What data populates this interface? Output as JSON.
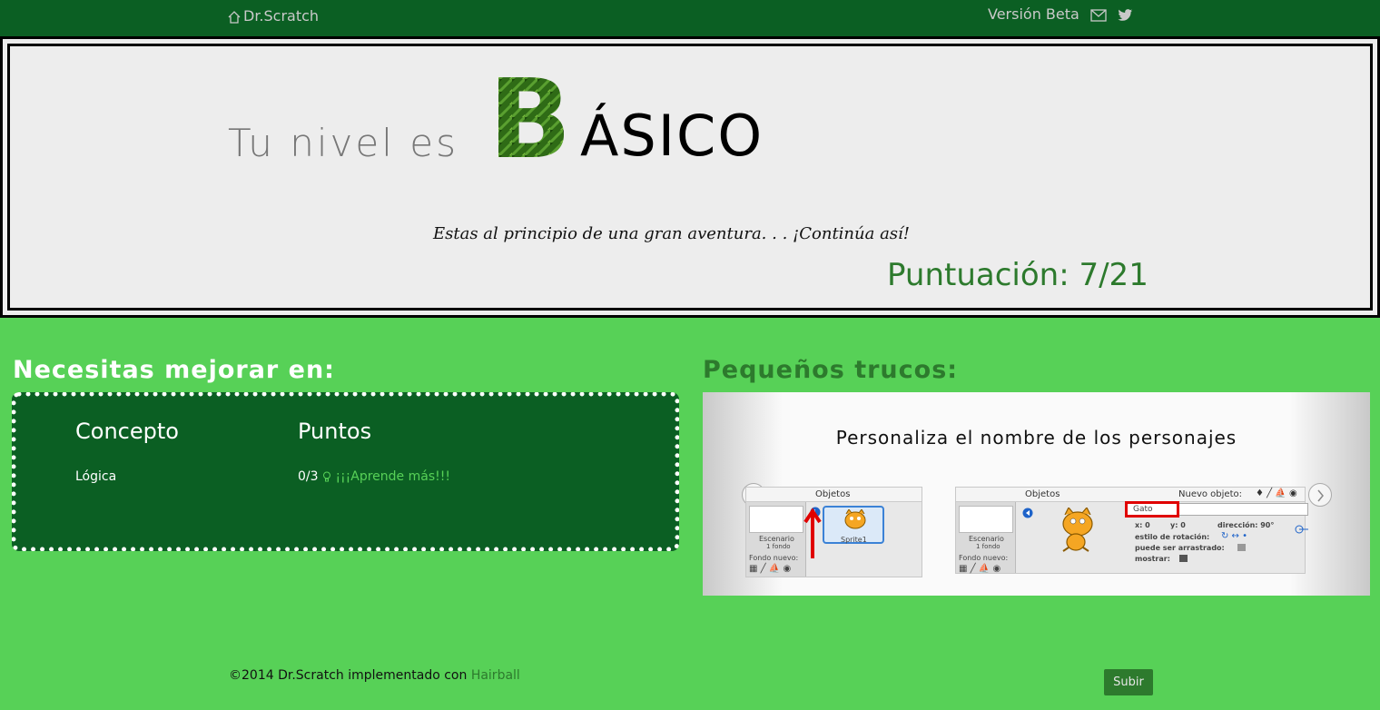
{
  "navbar": {
    "brand": "Dr.Scratch",
    "version": "Versión Beta",
    "icons": [
      "home-icon",
      "mail-icon",
      "twitter-icon"
    ]
  },
  "hero": {
    "prefix": "Tu nivel es",
    "level_initial": "B",
    "level_rest": "ÁSICO",
    "message": "Estas al principio de una gran aventura. . . ¡Continúa así!",
    "score": "Puntuación: 7/21"
  },
  "improve": {
    "title": "Necesitas mejorar en:",
    "col_concept": "Concepto",
    "col_points": "Puntos",
    "rows": [
      {
        "concept": "Lógica",
        "points": "0/3",
        "link": "¡¡¡Aprende más!!!"
      }
    ]
  },
  "tips": {
    "title": "Pequeños trucos:",
    "slide_title": "Personaliza el nombre de los personajes",
    "shot_left": {
      "header": "Objetos",
      "stage_label": "Escenario",
      "stage_sub": "1 fondo",
      "new_bg": "Fondo nuevo:",
      "sprite_label": "Sprite1"
    },
    "shot_right": {
      "header": "Objetos",
      "new_object": "Nuevo objeto:",
      "stage_label": "Escenario",
      "stage_sub": "1 fondo",
      "new_bg": "Fondo nuevo:",
      "name_field": "Gato",
      "x": "x: 0",
      "y": "y: 0",
      "direction": "dirección: 90°",
      "rotation": "estilo de rotación:",
      "draggable": "puede ser arrastrado:",
      "show": "mostrar:"
    }
  },
  "footer": {
    "text": "©2014 Dr.Scratch implementado con",
    "link": "Hairball",
    "button": "Subir"
  },
  "colors": {
    "background": "#57d157",
    "dark_green": "#0b5f23",
    "mid_green": "#2d7a2d",
    "hero_bg": "#ededed"
  }
}
